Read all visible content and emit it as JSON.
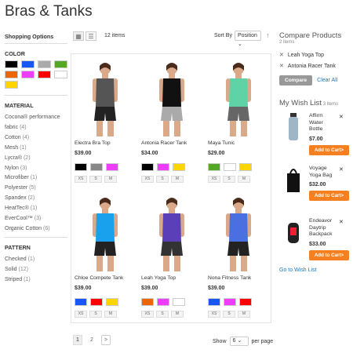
{
  "page": {
    "title": "Bras & Tanks"
  },
  "sidebar": {
    "heading": "Shopping Options",
    "color_label": "COLOR",
    "colors": [
      "#000000",
      "#1857f7",
      "#aaaaaa",
      "#53a828",
      "#eb6703",
      "#ef3dff",
      "#ff0000",
      "#ffffff",
      "#ffd500"
    ],
    "material_label": "MATERIAL",
    "materials": [
      {
        "name": "Cocona® performance fabric",
        "count": "(4)"
      },
      {
        "name": "Cotton",
        "count": "(4)"
      },
      {
        "name": "Mesh",
        "count": "(1)"
      },
      {
        "name": "Lycra®",
        "count": "(2)"
      },
      {
        "name": "Nylon",
        "count": "(3)"
      },
      {
        "name": "Microfiber",
        "count": "(1)"
      },
      {
        "name": "Polyester",
        "count": "(5)"
      },
      {
        "name": "Spandex",
        "count": "(2)"
      },
      {
        "name": "HeatTec®",
        "count": "(1)"
      },
      {
        "name": "EverCool™",
        "count": "(3)"
      },
      {
        "name": "Organic Cotton",
        "count": "(6)"
      }
    ],
    "pattern_label": "PATTERN",
    "patterns": [
      {
        "name": "Checked",
        "count": "(1)"
      },
      {
        "name": "Solid",
        "count": "(12)"
      },
      {
        "name": "Striped",
        "count": "(1)"
      }
    ]
  },
  "toolbar": {
    "items": "12 items",
    "sort_label": "Sort By",
    "sort_value": "Position"
  },
  "products": [
    {
      "name": "Electra Bra Top",
      "price": "$39.00",
      "colors": [
        "#000000",
        "#888888",
        "#ef3dff"
      ],
      "sizes": [
        "XS",
        "S",
        "M"
      ],
      "top_color": "#555555",
      "bottom_color": "#222222"
    },
    {
      "name": "Antonia Racer Tank",
      "price": "$34.00",
      "colors": [
        "#000000",
        "#ef3dff",
        "#ffd500"
      ],
      "sizes": [
        "XS",
        "S",
        "M"
      ],
      "top_color": "#111111",
      "bottom_color": "#aaaaaa"
    },
    {
      "name": "Maya Tunic",
      "price": "$29.00",
      "colors": [
        "#53a828",
        "#ffffff",
        "#ffd500"
      ],
      "sizes": [
        "XS",
        "S",
        "M"
      ],
      "top_color": "#5fd3a6",
      "bottom_color": "#666666"
    },
    {
      "name": "Chloe Compete Tank",
      "price": "$39.00",
      "colors": [
        "#1857f7",
        "#ff0000",
        "#ffd500"
      ],
      "sizes": [
        "XS",
        "S",
        "M"
      ],
      "top_color": "#1aa1ee",
      "bottom_color": "#222222"
    },
    {
      "name": "Leah Yoga Top",
      "price": "$39.00",
      "colors": [
        "#eb6703",
        "#ef3dff",
        "#ffffff"
      ],
      "sizes": [
        "XS",
        "S",
        "M"
      ],
      "top_color": "#5b3fb8",
      "bottom_color": "#333333"
    },
    {
      "name": "Nona Fitness Tank",
      "price": "$39.00",
      "colors": [
        "#1857f7",
        "#ef3dff",
        "#ff0000"
      ],
      "sizes": [
        "XS",
        "S",
        "M"
      ],
      "top_color": "#4a6fe0",
      "bottom_color": "#222222"
    }
  ],
  "pager": {
    "pages": [
      "1",
      "2"
    ],
    "next": ">",
    "show_label": "Show",
    "show_value": "6",
    "per_page": "per page"
  },
  "compare": {
    "title": "Compare Products",
    "count": "2 items",
    "items": [
      "Leah Yoga Top",
      "Antonia Racer Tank"
    ],
    "compare_btn": "Compare",
    "clear": "Clear All"
  },
  "wishlist": {
    "title": "My Wish List",
    "count": "3 items",
    "items": [
      {
        "name": "Affirm Water Bottle",
        "price": "$7.00",
        "button": "Add to Cart>"
      },
      {
        "name": "Voyage Yoga Bag",
        "price": "$32.00",
        "button": "Add to Cart>"
      },
      {
        "name": "Endeavor Daytrip Backpack",
        "price": "$33.00",
        "button": "Add to Cart>"
      }
    ],
    "link": "Go to Wish List"
  }
}
